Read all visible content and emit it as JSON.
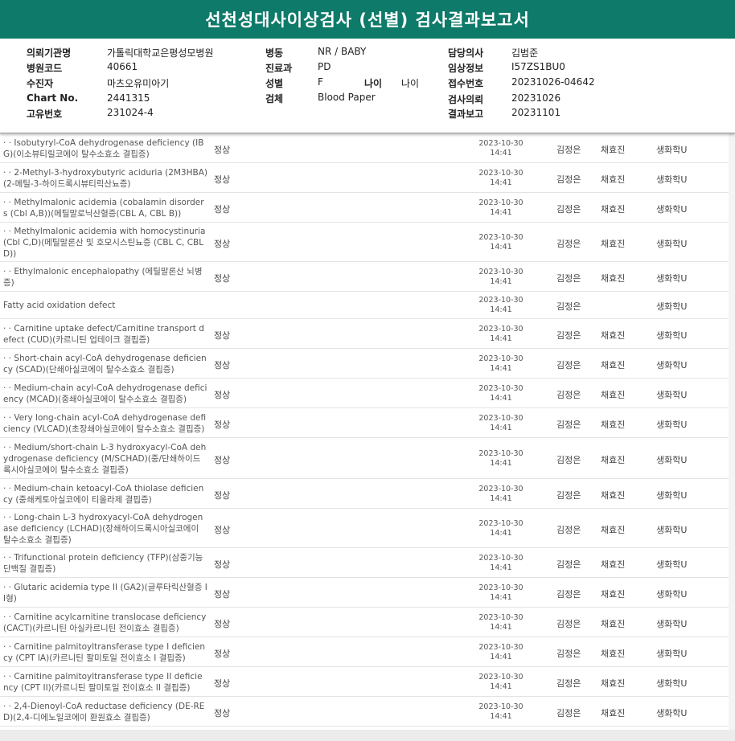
{
  "title": "선천성대사이상검사 (선별) 검사결과보고서",
  "info": {
    "col1": [
      {
        "label": "의뢰기관명",
        "value": "가톨릭대학교은평성모병원"
      },
      {
        "label": "병원코드",
        "value": "40661"
      },
      {
        "label": "수진자",
        "value": "마츠오유미아기"
      },
      {
        "label": "Chart No.",
        "value": "2441315"
      },
      {
        "label": "고유번호",
        "value": "231024-4"
      }
    ],
    "col2": [
      {
        "label": "병동",
        "value": "NR / BABY"
      },
      {
        "label": "진료과",
        "value": "PD"
      },
      {
        "label": "성별",
        "value": "F"
      },
      {
        "label": "검체",
        "value": "Blood Paper"
      }
    ],
    "age": {
      "label": "나이",
      "value": "나이"
    },
    "col3": [
      {
        "label": "담당의사",
        "value": "김범준"
      },
      {
        "label": "임상정보",
        "value": "I57ZS1BU0"
      },
      {
        "label": "접수번호",
        "value": "20231026-04642"
      },
      {
        "label": "검사의뢰",
        "value": "20231026"
      },
      {
        "label": "결과보고",
        "value": "20231101"
      }
    ]
  },
  "rows": [
    {
      "name": "  · · Isobutyryl-CoA dehydrogenase deficiency (IBG)(이소뷰티릴코에이 탈수소효소 결핍증)",
      "result": "정상",
      "date": "2023-10-30",
      "time": "14:41",
      "c1": "김정은",
      "c2": "채효진",
      "c3": "생화학U"
    },
    {
      "name": "  · · 2-Methyl-3-hydroxybutyric aciduria (2M3HBA)(2-메틸-3-하이드록시뷰티릭산뇨증)",
      "result": "정상",
      "date": "2023-10-30",
      "time": "14:41",
      "c1": "김정은",
      "c2": "채효진",
      "c3": "생화학U"
    },
    {
      "name": "  · · Methylmalonic acidemia (cobalamin disorders (Cbl A,B))(메틸말로닉산혈증(CBL A, CBL B))",
      "result": "정상",
      "date": "2023-10-30",
      "time": "14:41",
      "c1": "김정은",
      "c2": "채효진",
      "c3": "생화학U"
    },
    {
      "name": "  · · Methylmalonic acidemia with homocystinuria (Cbl C,D)(메틸말론산 및 호모시스틴뇨증 (CBL C, CBL D))",
      "result": "정상",
      "date": "2023-10-30",
      "time": "14:41",
      "c1": "김정은",
      "c2": "채효진",
      "c3": "생화학U"
    },
    {
      "name": "  · · Ethylmalonic encephalopathy (에틸말론산 뇌병증)",
      "result": "정상",
      "date": "2023-10-30",
      "time": "14:41",
      "c1": "김정은",
      "c2": "채효진",
      "c3": "생화학U"
    },
    {
      "name": "  Fatty acid oxidation defect",
      "result": "",
      "date": "2023-10-30",
      "time": "14:41",
      "c1": "김정은",
      "c2": "",
      "c3": "생화학U"
    },
    {
      "name": "  · · Carnitine uptake defect/Carnitine transport defect (CUD)(카르니틴 업테이크 결핍증)",
      "result": "정상",
      "date": "2023-10-30",
      "time": "14:41",
      "c1": "김정은",
      "c2": "채효진",
      "c3": "생화학U"
    },
    {
      "name": "  · · Short-chain acyl-CoA dehydrogenase deficiency (SCAD)(단쇄아실코에이 탈수소효소 결핍증)",
      "result": "정상",
      "date": "2023-10-30",
      "time": "14:41",
      "c1": "김정은",
      "c2": "채효진",
      "c3": "생화학U"
    },
    {
      "name": "  · · Medium-chain acyl-CoA dehydrogenase deficiency (MCAD)(중쇄아실코에이 탈수소효소 결핍증)",
      "result": "정상",
      "date": "2023-10-30",
      "time": "14:41",
      "c1": "김정은",
      "c2": "채효진",
      "c3": "생화학U"
    },
    {
      "name": "  · · Very long-chain acyl-CoA dehydrogenase deficiency (VLCAD)(초장쇄아실코에이 탈수소효소 결핍증)",
      "result": "정상",
      "date": "2023-10-30",
      "time": "14:41",
      "c1": "김정은",
      "c2": "채효진",
      "c3": "생화학U"
    },
    {
      "name": "  · · Medium/short-chain L-3 hydroxyacyl-CoA dehydrogenase deficiency (M/SCHAD)(중/단쇄하이드록시아실코에이 탈수소효소 결핍증)",
      "result": "정상",
      "date": "2023-10-30",
      "time": "14:41",
      "c1": "김정은",
      "c2": "채효진",
      "c3": "생화학U"
    },
    {
      "name": "  · · Medium-chain ketoacyl-CoA thiolase deficiency (중쇄케토아실코에이 티올라제 결핍증)",
      "result": "정상",
      "date": "2023-10-30",
      "time": "14:41",
      "c1": "김정은",
      "c2": "채효진",
      "c3": "생화학U"
    },
    {
      "name": "  · · Long-chain L-3 hydroxyacyl-CoA dehydrogenase deficiency (LCHAD)(장쇄하이드록시아실코에이 탈수소효소 결핍증)",
      "result": "정상",
      "date": "2023-10-30",
      "time": "14:41",
      "c1": "김정은",
      "c2": "채효진",
      "c3": "생화학U"
    },
    {
      "name": "  · · Trifunctional protein deficiency (TFP)(삼중기능 단백질 결핍증)",
      "result": "정상",
      "date": "2023-10-30",
      "time": "14:41",
      "c1": "김정은",
      "c2": "채효진",
      "c3": "생화학U"
    },
    {
      "name": "  · · Glutaric acidemia type II (GA2)(글루타릭산혈증 II형)",
      "result": "정상",
      "date": "2023-10-30",
      "time": "14:41",
      "c1": "김정은",
      "c2": "채효진",
      "c3": "생화학U"
    },
    {
      "name": "  · · Carnitine acylcarnitine translocase deficiency (CACT)(카르니틴 아실카르니틴 전이효소 결핍증)",
      "result": "정상",
      "date": "2023-10-30",
      "time": "14:41",
      "c1": "김정은",
      "c2": "채효진",
      "c3": "생화학U"
    },
    {
      "name": "  · · Carnitine palmitoyltransferase type I deficiency (CPT IA)(카르니틴 팔미토일 전이효소 I 결핍증)",
      "result": "정상",
      "date": "2023-10-30",
      "time": "14:41",
      "c1": "김정은",
      "c2": "채효진",
      "c3": "생화학U"
    },
    {
      "name": "  · · Carnitine palmitoyltransferase type II deficiency (CPT II)(카르니틴 팔미토일 전이효소 II 결핍증)",
      "result": "정상",
      "date": "2023-10-30",
      "time": "14:41",
      "c1": "김정은",
      "c2": "채효진",
      "c3": "생화학U"
    },
    {
      "name": "  · · 2,4-Dienoyl-CoA reductase deficiency (DE-RED)(2,4-디에노일코에이 환원효소 결핍증)",
      "result": "정상",
      "date": "2023-10-30",
      "time": "14:41",
      "c1": "김정은",
      "c2": "채효진",
      "c3": "생화학U"
    }
  ]
}
